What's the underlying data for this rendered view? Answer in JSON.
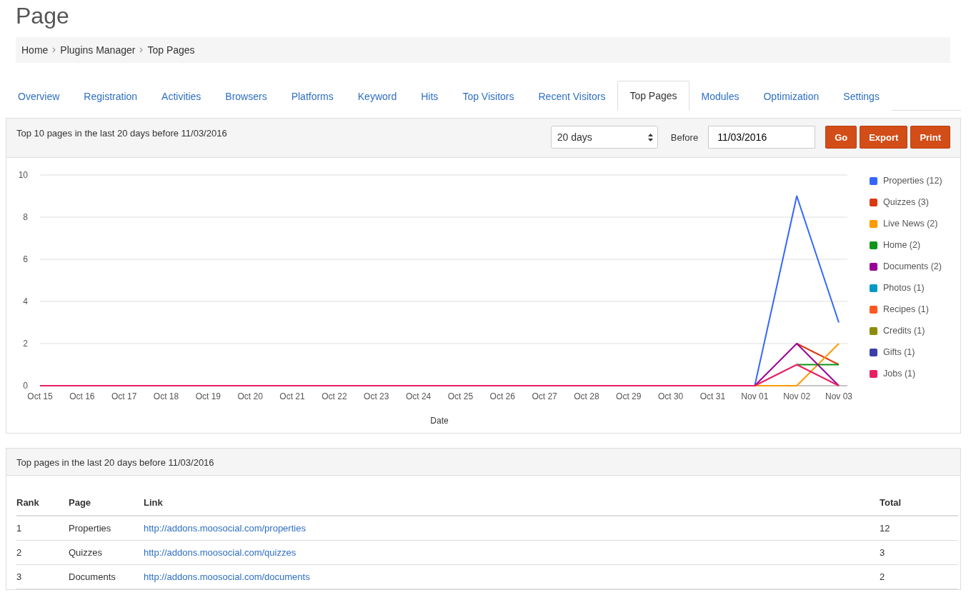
{
  "page_title": "Page",
  "breadcrumb": [
    {
      "label": "Home"
    },
    {
      "label": "Plugins Manager"
    },
    {
      "label": "Top Pages"
    }
  ],
  "tabs": [
    {
      "label": "Overview",
      "selected": false
    },
    {
      "label": "Registration",
      "selected": false
    },
    {
      "label": "Activities",
      "selected": false
    },
    {
      "label": "Browsers",
      "selected": false
    },
    {
      "label": "Platforms",
      "selected": false
    },
    {
      "label": "Keyword",
      "selected": false
    },
    {
      "label": "Hits",
      "selected": false
    },
    {
      "label": "Top Visitors",
      "selected": false
    },
    {
      "label": "Recent Visitors",
      "selected": false
    },
    {
      "label": "Top Pages",
      "selected": true
    },
    {
      "label": "Modules",
      "selected": false
    },
    {
      "label": "Optimization",
      "selected": false
    },
    {
      "label": "Settings",
      "selected": false
    }
  ],
  "chart_panel": {
    "heading": "Top 10 pages in the last 20 days before 11/03/2016",
    "period_select": {
      "value": "20 days"
    },
    "before_label": "Before",
    "date_field": {
      "value": "11/03/2016"
    },
    "buttons": [
      "Go",
      "Export",
      "Print"
    ],
    "chart_data": {
      "type": "line",
      "xlabel": "Date",
      "categories": [
        "Oct 15",
        "Oct 16",
        "Oct 17",
        "Oct 18",
        "Oct 19",
        "Oct 20",
        "Oct 21",
        "Oct 22",
        "Oct 23",
        "Oct 24",
        "Oct 25",
        "Oct 26",
        "Oct 27",
        "Oct 28",
        "Oct 29",
        "Oct 30",
        "Oct 31",
        "Nov 01",
        "Nov 02",
        "Nov 03"
      ],
      "grid": true,
      "ylim": [
        0,
        10
      ],
      "yticks": [
        0,
        2,
        4,
        6,
        8,
        10
      ],
      "series": [
        {
          "name": "Properties (12)",
          "color": "#3366ff",
          "values": [
            null,
            null,
            null,
            null,
            null,
            null,
            null,
            null,
            null,
            null,
            null,
            null,
            null,
            null,
            null,
            null,
            null,
            0,
            9,
            3
          ]
        },
        {
          "name": "Quizzes (3)",
          "color": "#dc3912",
          "values": [
            null,
            null,
            null,
            null,
            null,
            null,
            null,
            null,
            null,
            null,
            null,
            null,
            null,
            null,
            null,
            null,
            null,
            null,
            2,
            1
          ]
        },
        {
          "name": "Live News (2)",
          "color": "#ff9900",
          "values": [
            null,
            null,
            null,
            null,
            null,
            null,
            null,
            null,
            null,
            null,
            null,
            null,
            null,
            null,
            null,
            null,
            null,
            0,
            0,
            2
          ]
        },
        {
          "name": "Home (2)",
          "color": "#109618",
          "values": [
            null,
            null,
            null,
            null,
            null,
            null,
            null,
            null,
            null,
            null,
            null,
            null,
            null,
            null,
            null,
            null,
            null,
            null,
            1,
            1
          ]
        },
        {
          "name": "Documents (2)",
          "color": "#990099",
          "values": [
            null,
            null,
            null,
            null,
            null,
            null,
            null,
            null,
            null,
            null,
            null,
            null,
            null,
            null,
            null,
            null,
            null,
            0,
            2,
            0
          ]
        },
        {
          "name": "Photos (1)",
          "color": "#0099c6",
          "values": [
            null,
            null,
            null,
            null,
            null,
            null,
            null,
            null,
            null,
            null,
            null,
            null,
            null,
            null,
            null,
            null,
            null,
            null,
            null,
            null
          ]
        },
        {
          "name": "Recipes (1)",
          "color": "#ff5722",
          "values": [
            null,
            null,
            null,
            null,
            null,
            null,
            null,
            null,
            null,
            null,
            null,
            null,
            null,
            null,
            null,
            null,
            null,
            null,
            null,
            null
          ]
        },
        {
          "name": "Credits (1)",
          "color": "#8c8c0a",
          "values": [
            null,
            null,
            null,
            null,
            null,
            null,
            null,
            null,
            null,
            null,
            null,
            null,
            null,
            null,
            null,
            null,
            null,
            null,
            null,
            null
          ]
        },
        {
          "name": "Gifts (1)",
          "color": "#3b3eac",
          "values": [
            null,
            null,
            null,
            null,
            null,
            null,
            null,
            null,
            null,
            null,
            null,
            null,
            null,
            null,
            null,
            null,
            null,
            null,
            null,
            null
          ]
        },
        {
          "name": "Jobs (1)",
          "color": "#e91e63",
          "values": [
            0,
            0,
            0,
            0,
            0,
            0,
            0,
            0,
            0,
            0,
            0,
            0,
            0,
            0,
            0,
            0,
            0,
            0,
            1,
            0
          ]
        }
      ]
    }
  },
  "table_panel": {
    "heading": "Top pages in the last 20 days before 11/03/2016",
    "columns": [
      "Rank",
      "Page",
      "Link",
      "Total"
    ],
    "rows": [
      {
        "rank": "1",
        "page": "Properties",
        "link": "http://addons.moosocial.com/properties",
        "total": "12"
      },
      {
        "rank": "2",
        "page": "Quizzes",
        "link": "http://addons.moosocial.com/quizzes",
        "total": "3"
      },
      {
        "rank": "3",
        "page": "Documents",
        "link": "http://addons.moosocial.com/documents",
        "total": "2"
      }
    ]
  }
}
